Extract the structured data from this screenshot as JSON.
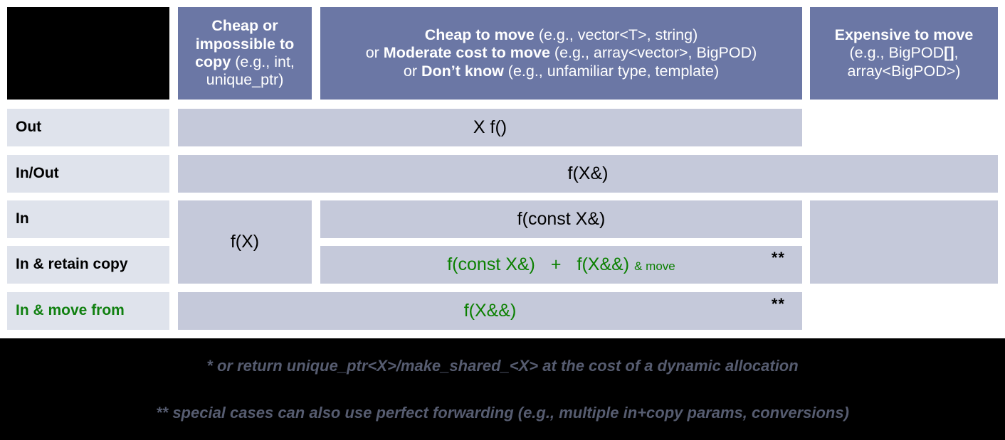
{
  "colors": {
    "header_bg": "#6b77a5",
    "header_text": "#ffffff",
    "row_label_bg": "#dfe3ec",
    "cell_bg": "#c5c9da",
    "accent_green": "#0b8000",
    "footer_bg": "#000000",
    "footer_text": "#565c70",
    "corner_bg": "#000000"
  },
  "header": {
    "corner": "",
    "col1": {
      "line1_bold": "Cheap or",
      "line2_bold": "impossible to",
      "line3_bold": "copy",
      "line3_rest": " (e.g., int,",
      "line4_rest": "unique_ptr)"
    },
    "col2": {
      "line1_bold": "Cheap to move",
      "line1_rest": " (e.g., vector<T>, string)",
      "line2_pre": "or ",
      "line2_bold": "Moderate cost to move",
      "line2_rest": " (e.g., array<vector>, BigPOD)",
      "line3_pre": "or ",
      "line3_bold": "Don’t know",
      "line3_rest": " (e.g., unfamiliar type, template)"
    },
    "col3": {
      "line1_bold": "Expensive to move",
      "line2_rest": "(e.g., BigPOD",
      "line2_bold": "[]",
      "line2_tail": ",",
      "line3_rest": "array<BigPOD>)"
    }
  },
  "rows": [
    {
      "label": "Out",
      "label_color": "black"
    },
    {
      "label": "In/Out",
      "label_color": "black"
    },
    {
      "label": "In",
      "label_color": "black"
    },
    {
      "label": "In & retain copy",
      "label_color": "black"
    },
    {
      "label": "In & move from",
      "label_color": "green"
    }
  ],
  "cells": {
    "out_main": "X f()",
    "inout_main": "f(X&)",
    "in_cheap": "f(X)",
    "in_main": "f(const X&)",
    "retain_left": "f(const X&)",
    "retain_plus": "+",
    "retain_right": "f(X&&)",
    "retain_suffix": "& move",
    "retain_mark": "**",
    "movefrom_main": "f(X&&)",
    "movefrom_mark": "**",
    "expensive_out": "",
    "expensive_in": ""
  },
  "footnotes": {
    "one": "* or return unique_ptr<X>/make_shared_<X> at the cost of a dynamic allocation",
    "two": "** special cases can also use perfect forwarding (e.g., multiple in+copy params, conversions)"
  }
}
